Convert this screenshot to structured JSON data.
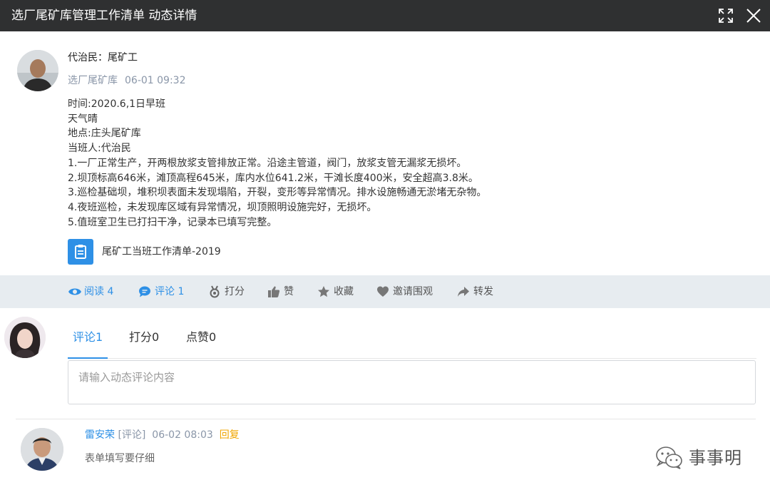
{
  "window": {
    "title": "选厂尾矿库管理工作清单 动态详情"
  },
  "post": {
    "author": "代治民：尾矿工",
    "group": "选厂尾矿库",
    "time": "06-01 09:32",
    "lines": [
      "时间:2020.6,1日早班",
      "天气晴",
      "地点:庄头尾矿库",
      "当班人:代治民",
      "1.一厂正常生产，开两根放浆支管排放正常。沿途主管道，阀门，放浆支管无漏浆无损坏。",
      "2.坝顶标高646米，滩顶高程645米，库内水位641.2米，干滩长度400米，安全超高3.8米。",
      "3.巡检基础坝，堆积坝表面未发现塌陷，开裂，变形等异常情况。排水设施畅通无淤堵无杂物。",
      "4.夜班巡检，未发现库区域有异常情况，坝顶照明设施完好，无损坏。",
      "5.值班室卫生已打扫干净，记录本已填写完整。"
    ],
    "attachment": {
      "name": "尾矿工当班工作清单-2019",
      "icon": "clipboard-icon"
    }
  },
  "actions": {
    "read": {
      "label": "阅读",
      "count": "4"
    },
    "comment": {
      "label": "评论",
      "count": "1"
    },
    "score": {
      "label": "打分"
    },
    "like": {
      "label": "赞"
    },
    "favorite": {
      "label": "收藏"
    },
    "invite": {
      "label": "邀请围观"
    },
    "forward": {
      "label": "转发"
    }
  },
  "tabs": [
    {
      "label": "评论1",
      "active": true
    },
    {
      "label": "打分0",
      "active": false
    },
    {
      "label": "点赞0",
      "active": false
    }
  ],
  "comment_box": {
    "placeholder": "请输入动态评论内容"
  },
  "comments": [
    {
      "name": "雷安荣",
      "type": "[评论]",
      "time": "06-02 08:03",
      "reply": "回复",
      "text": "表单填写要仔细"
    }
  ],
  "watermark": {
    "text": "事事明"
  },
  "colors": {
    "accent": "#2e90e6",
    "titlebar": "#2f3031",
    "actionbar": "#e7ecf0",
    "reply": "#f0a600"
  }
}
